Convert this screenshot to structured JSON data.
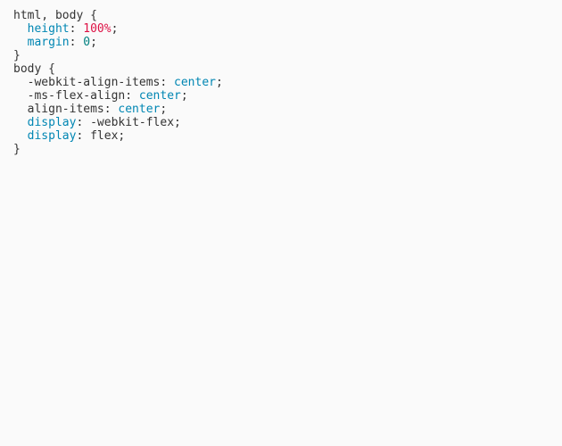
{
  "code": {
    "lines": [
      {
        "indent": "",
        "segments": [
          {
            "cls": "t",
            "text": "html, body {"
          }
        ]
      },
      {
        "indent": "  ",
        "segments": [
          {
            "cls": "prop",
            "text": "height"
          },
          {
            "cls": "t",
            "text": ": "
          },
          {
            "cls": "num",
            "text": "100%"
          },
          {
            "cls": "t",
            "text": ";"
          }
        ]
      },
      {
        "indent": "  ",
        "segments": [
          {
            "cls": "prop",
            "text": "margin"
          },
          {
            "cls": "t",
            "text": ": "
          },
          {
            "cls": "teal",
            "text": "0"
          },
          {
            "cls": "t",
            "text": ";"
          }
        ]
      },
      {
        "indent": "",
        "segments": [
          {
            "cls": "t",
            "text": "}"
          }
        ]
      },
      {
        "indent": "",
        "segments": [
          {
            "cls": "t",
            "text": ""
          }
        ]
      },
      {
        "indent": "",
        "segments": [
          {
            "cls": "t",
            "text": "body {"
          }
        ]
      },
      {
        "indent": "  ",
        "segments": [
          {
            "cls": "t",
            "text": "-webkit-align-items: "
          },
          {
            "cls": "val",
            "text": "center"
          },
          {
            "cls": "t",
            "text": ";"
          }
        ]
      },
      {
        "indent": "  ",
        "segments": [
          {
            "cls": "t",
            "text": "-ms-flex-align: "
          },
          {
            "cls": "val",
            "text": "center"
          },
          {
            "cls": "t",
            "text": ";"
          }
        ]
      },
      {
        "indent": "  ",
        "segments": [
          {
            "cls": "t",
            "text": "align-items: "
          },
          {
            "cls": "val",
            "text": "center"
          },
          {
            "cls": "t",
            "text": ";"
          }
        ]
      },
      {
        "indent": "  ",
        "segments": [
          {
            "cls": "prop",
            "text": "display"
          },
          {
            "cls": "t",
            "text": ": -webkit-flex;"
          }
        ]
      },
      {
        "indent": "  ",
        "segments": [
          {
            "cls": "prop",
            "text": "display"
          },
          {
            "cls": "t",
            "text": ": flex;"
          }
        ]
      },
      {
        "indent": "",
        "segments": [
          {
            "cls": "t",
            "text": "}"
          }
        ]
      }
    ]
  }
}
